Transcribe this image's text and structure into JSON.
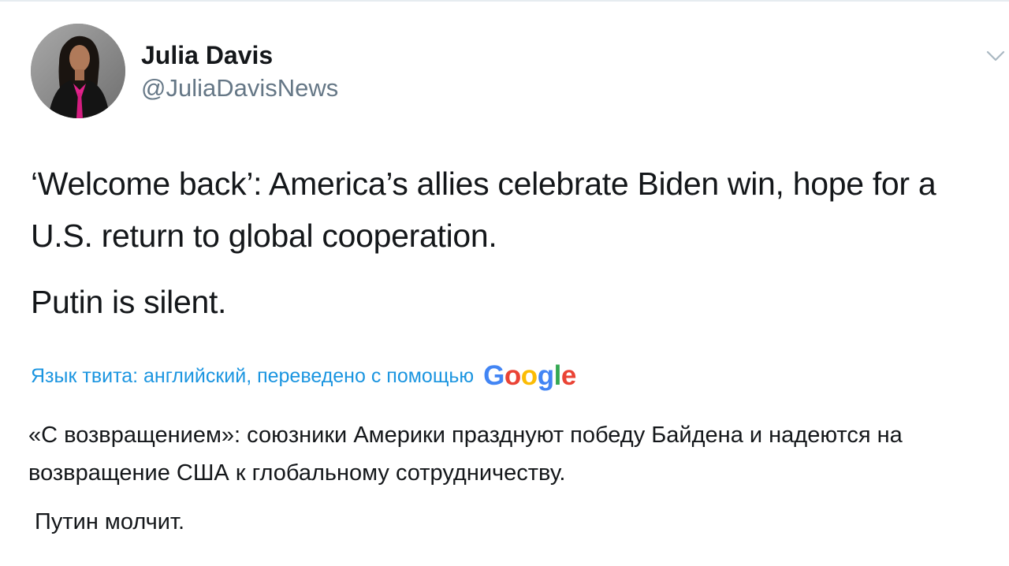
{
  "author": {
    "display_name": "Julia Davis",
    "handle": "@JuliaDavisNews"
  },
  "tweet": {
    "paragraphs": [
      "‘Welcome back’: America’s allies celebrate Biden win, hope for a U.S. return to global cooperation.",
      "Putin is silent."
    ]
  },
  "translation": {
    "label": "Язык твита: английский, переведено с помощью",
    "provider_letters": [
      "G",
      "o",
      "o",
      "g",
      "l",
      "e"
    ],
    "provider_colors": [
      "#4285F4",
      "#EA4335",
      "#FBBC05",
      "#4285F4",
      "#34A853",
      "#EA4335"
    ],
    "paragraphs": [
      "«С возвращением»: союзники Америки празднуют победу Байдена и надеются на возвращение США к глобальному сотрудничеству.",
      "Путин молчит."
    ]
  },
  "icons": {
    "menu": "chevron-down-icon",
    "avatar": "avatar"
  },
  "colors": {
    "text": "#14171a",
    "secondary": "#657786",
    "link": "#1b95e0",
    "divider": "#e6ecf0"
  }
}
